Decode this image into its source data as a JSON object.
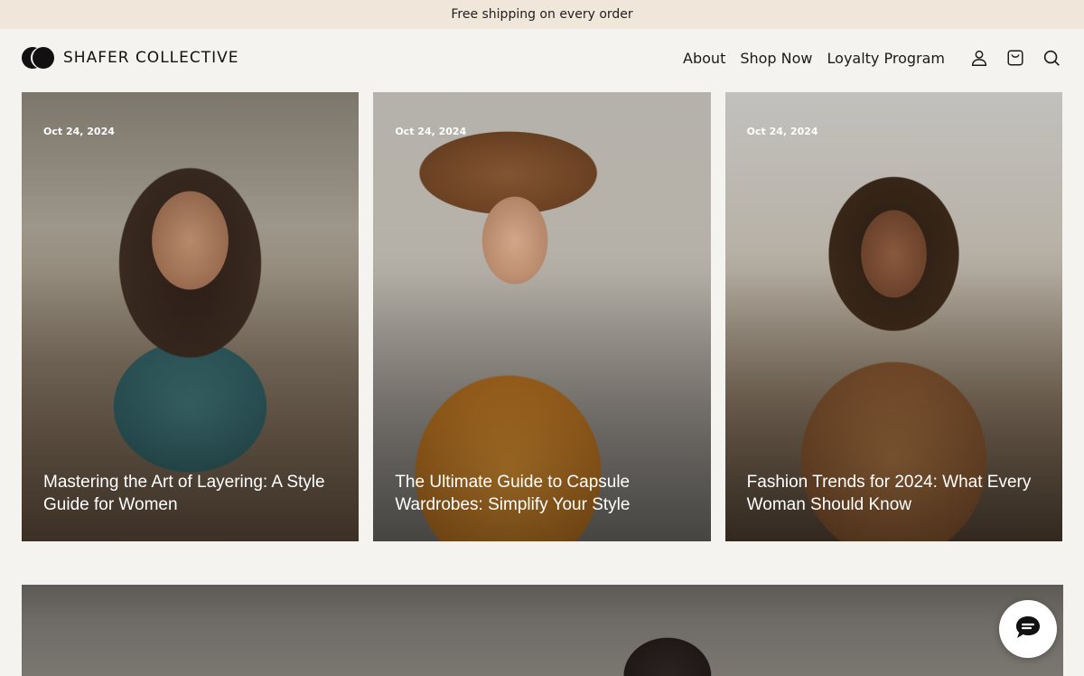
{
  "announcement": {
    "text": "Free shipping on every order"
  },
  "header": {
    "brand": "SHAFER COLLECTIVE",
    "nav": [
      {
        "label": "About"
      },
      {
        "label": "Shop Now"
      },
      {
        "label": "Loyalty Program"
      }
    ],
    "icons": [
      "account-icon",
      "cart-icon",
      "search-icon"
    ]
  },
  "cards": [
    {
      "date": "Oct 24, 2024",
      "title": "Mastering the Art of Layering: A Style Guide for Women"
    },
    {
      "date": "Oct 24, 2024",
      "title": "The Ultimate Guide to Capsule Wardrobes: Simplify Your Style"
    },
    {
      "date": "Oct 24, 2024",
      "title": "Fashion Trends for 2024: What Every Woman Should Know"
    }
  ],
  "chat": {
    "icon": "chat-icon"
  },
  "colors": {
    "announcement_bg": "#f0e6da",
    "page_bg": "#f5f3f0",
    "text": "#1a1a1a"
  }
}
